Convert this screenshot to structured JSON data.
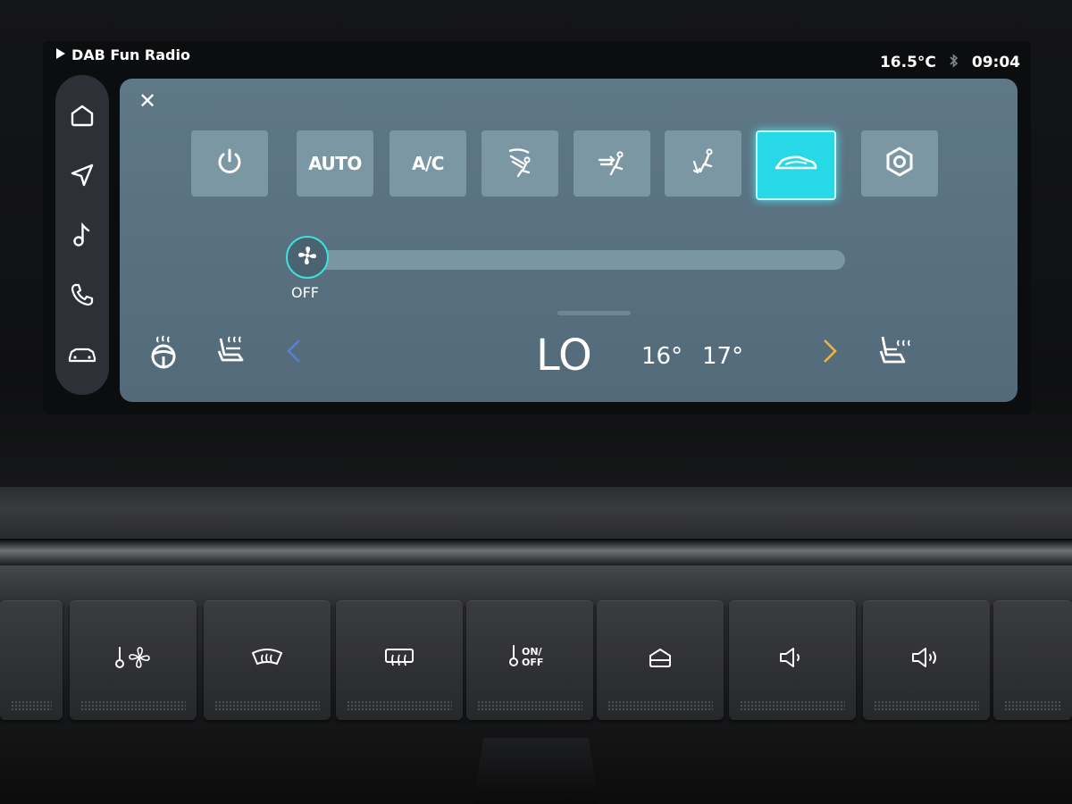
{
  "status": {
    "now_playing": "DAB Fun Radio",
    "outside_temp": "16.5°C",
    "bluetooth_icon": "bluetooth-icon",
    "time": "09:04"
  },
  "sidebar": {
    "items": [
      {
        "name": "home",
        "icon": "home-icon"
      },
      {
        "name": "navigation",
        "icon": "navigation-icon"
      },
      {
        "name": "music",
        "icon": "music-note-icon"
      },
      {
        "name": "phone",
        "icon": "phone-icon"
      },
      {
        "name": "vehicle",
        "icon": "car-icon"
      }
    ]
  },
  "climate": {
    "close_label": "✕",
    "buttons": [
      {
        "id": "power",
        "label": "",
        "icon": "power-icon",
        "active": false
      },
      {
        "id": "auto",
        "label": "AUTO",
        "active": false
      },
      {
        "id": "ac",
        "label": "A/C",
        "active": false
      },
      {
        "id": "air-windshield",
        "label": "",
        "icon": "airflow-windshield-icon",
        "active": false
      },
      {
        "id": "air-face",
        "label": "",
        "icon": "airflow-face-icon",
        "active": false
      },
      {
        "id": "air-feet",
        "label": "",
        "icon": "airflow-feet-icon",
        "active": false
      },
      {
        "id": "recirculation",
        "label": "",
        "icon": "recirculation-car-icon",
        "active": true
      },
      {
        "id": "settings",
        "label": "",
        "icon": "settings-hex-icon",
        "active": false
      }
    ],
    "fan": {
      "label": "OFF",
      "level": 0
    },
    "temperature": {
      "current": "LO",
      "option_a": "16°",
      "option_b": "17°"
    },
    "accent_color": "#27d9e6"
  },
  "hardware_buttons": [
    {
      "name": "climate-fan",
      "icon": "thermometer-fan-icon",
      "label": ""
    },
    {
      "name": "front-defrost",
      "icon": "front-defrost-icon",
      "label": ""
    },
    {
      "name": "rear-defrost",
      "icon": "rear-defrost-icon",
      "label": ""
    },
    {
      "name": "climate-on-off",
      "icon": "thermometer-icon",
      "label": "ON/ OFF"
    },
    {
      "name": "home",
      "icon": "home-icon",
      "label": ""
    },
    {
      "name": "volume-down",
      "icon": "volume-down-icon",
      "label": ""
    },
    {
      "name": "volume-up",
      "icon": "volume-up-icon",
      "label": ""
    }
  ]
}
